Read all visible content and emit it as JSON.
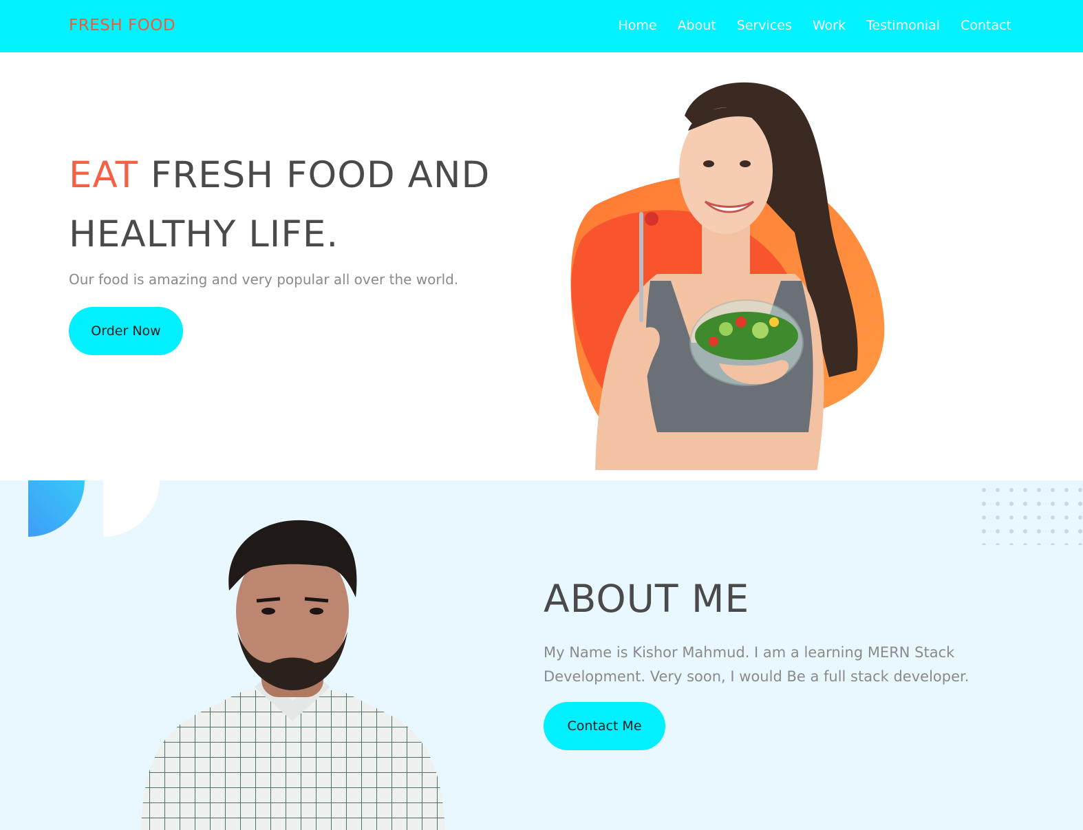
{
  "brand": "FRESH FOOD",
  "nav": [
    "Home",
    "About",
    "Services",
    "Work",
    "Testimonial",
    "Contact"
  ],
  "hero": {
    "title_accent": "EAT",
    "title_rest": " FRESH FOOD AND HEALTHY LIFE.",
    "subtitle": "Our food is amazing and very popular all over the world.",
    "button": "Order Now"
  },
  "about": {
    "title": "ABOUT ME",
    "text": "My Name is Kishor Mahmud. I am a learning MERN Stack Development. Very soon, I would Be a full stack developer.",
    "button": "Contact Me"
  },
  "colors": {
    "nav_bg": "#00f3ff",
    "accent": "#f56146",
    "button_bg": "#00f0ff",
    "about_bg": "#e9f7ff"
  }
}
